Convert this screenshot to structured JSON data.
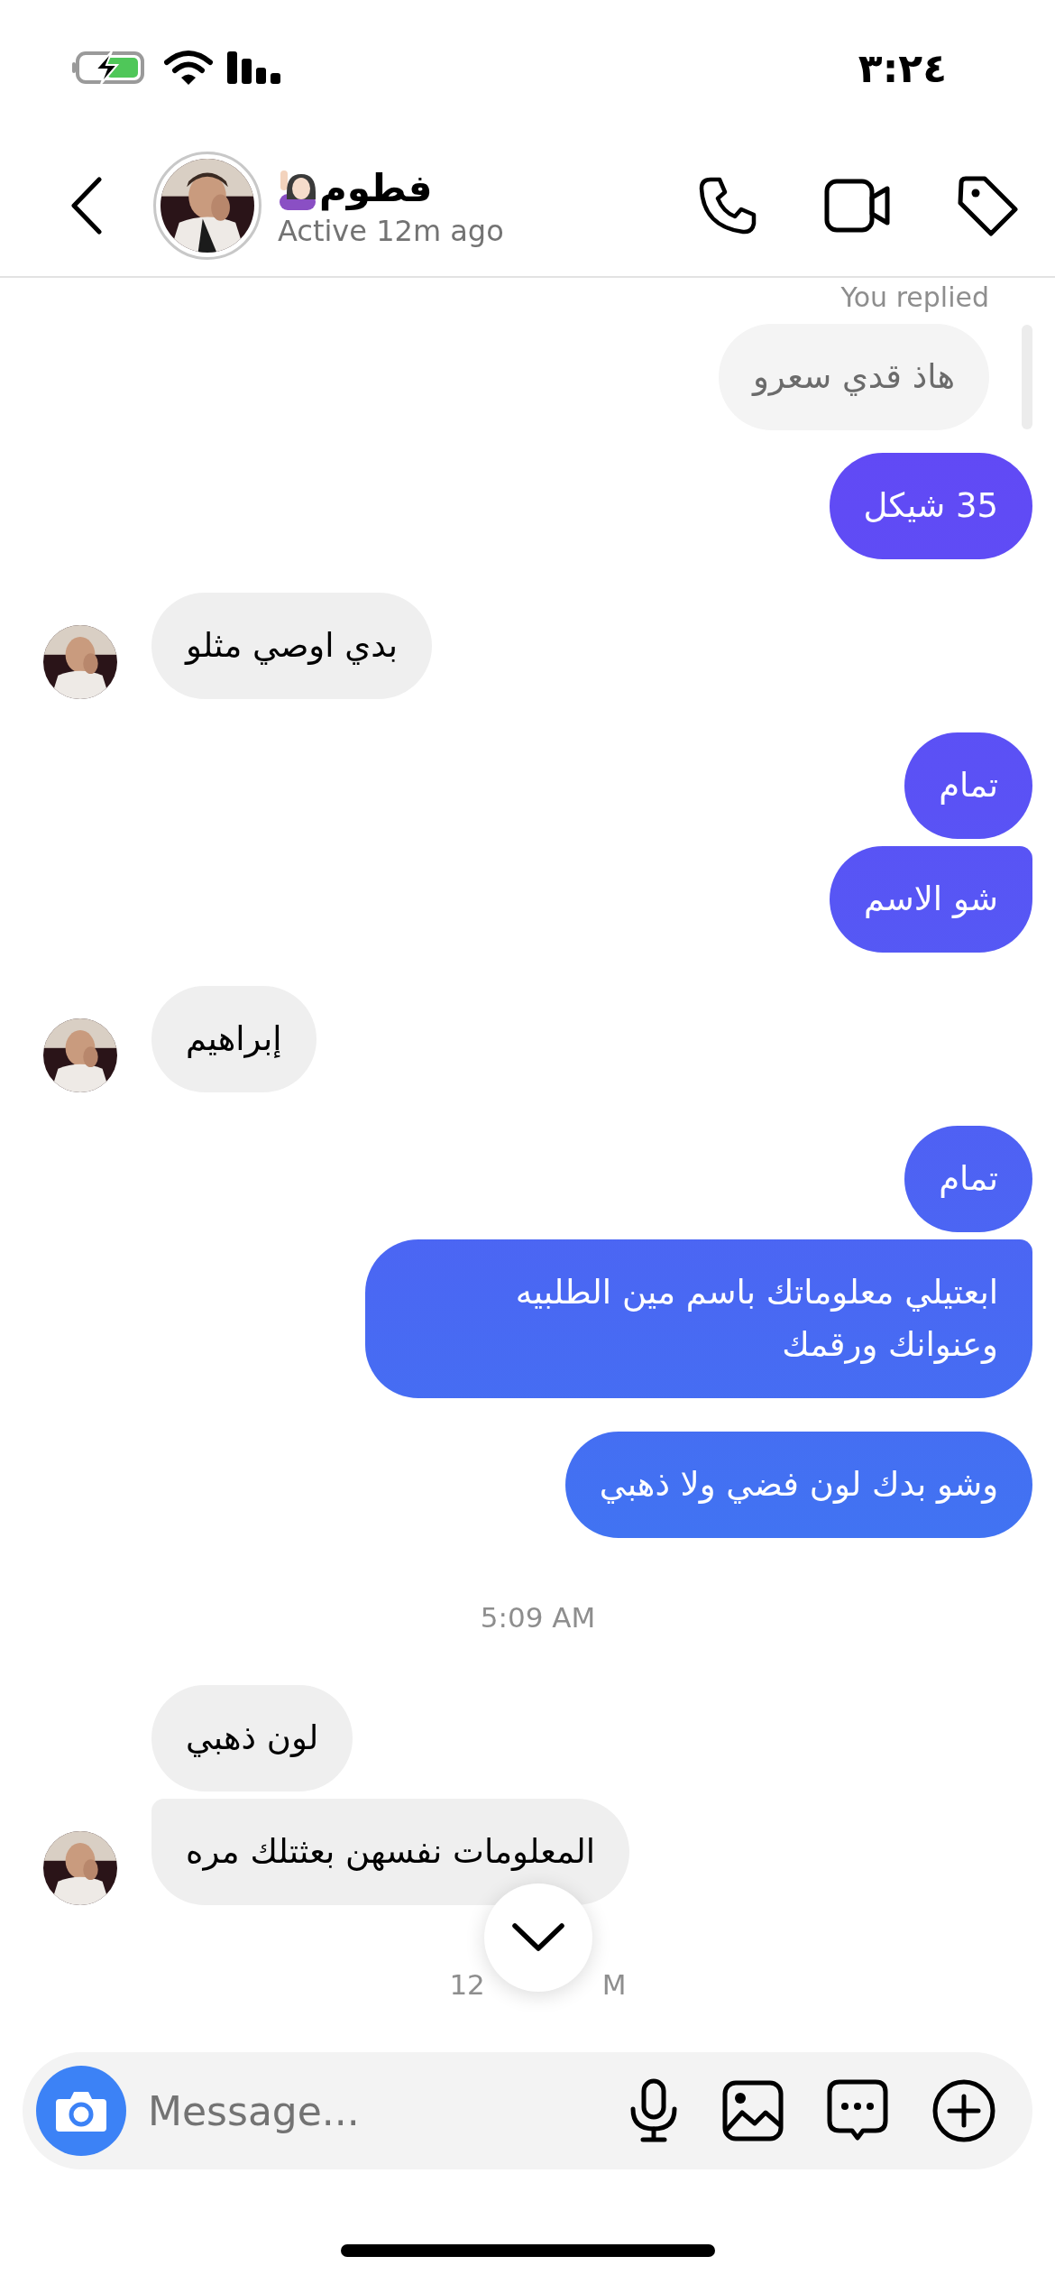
{
  "status_bar": {
    "time": "٣:٢٤"
  },
  "header": {
    "name": "فطوم",
    "status": "Active 12m ago"
  },
  "messages": [
    {
      "kind": "reply_label",
      "text": "You replied"
    },
    {
      "kind": "quote",
      "text": "هاذ قدي سعرو"
    },
    {
      "kind": "outgoing",
      "text": "35 شيكل",
      "joined": false
    },
    {
      "kind": "incoming",
      "text": "بدي اوصي مثلو",
      "avatar": true,
      "joined": false
    },
    {
      "kind": "outgoing",
      "text": "تمام",
      "joined": false
    },
    {
      "kind": "outgoing",
      "text": "شو الاسم",
      "joined": true
    },
    {
      "kind": "incoming",
      "text": "إبراهيم",
      "avatar": true,
      "joined": false
    },
    {
      "kind": "outgoing",
      "text": "تمام",
      "joined": false
    },
    {
      "kind": "outgoing",
      "text": "ابعتيلي معلوماتك باسم مين الطلبيه وعنوانك ورقمك",
      "joined": true
    },
    {
      "kind": "outgoing",
      "text": "وشو بدك لون فضي ولا ذهبي",
      "joined": false
    },
    {
      "kind": "time",
      "text": "5:09 AM"
    },
    {
      "kind": "incoming",
      "text": "لون ذهبي",
      "avatar": false,
      "joined": false
    },
    {
      "kind": "incoming",
      "text": "المعلومات نفسهن بعثتلك مره",
      "avatar": true,
      "joined": true
    },
    {
      "kind": "time_partial",
      "start": "12",
      "end": "M"
    }
  ],
  "composer": {
    "placeholder": "Message..."
  }
}
